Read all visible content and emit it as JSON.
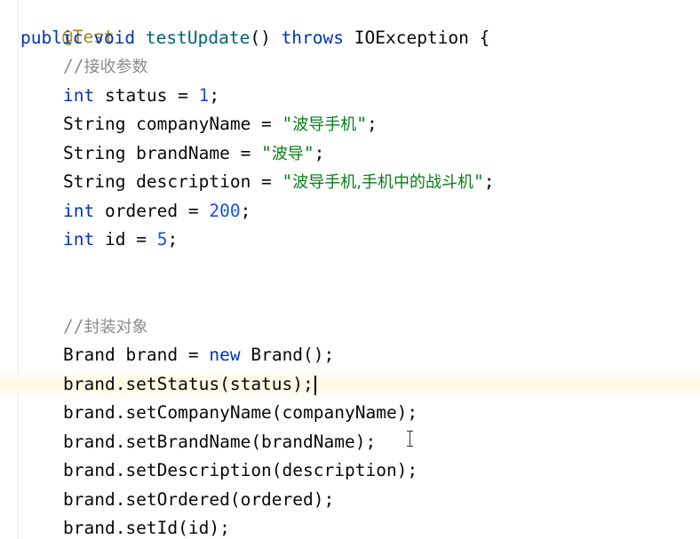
{
  "lines": {
    "l0": {
      "anno": "@Test"
    },
    "l1": {
      "kw1": "public",
      "kw2": "void",
      "name": "testUpdate",
      "rest1": "() ",
      "kw3": "throws",
      "rest2": " IOException {"
    },
    "l2": {
      "prefix": "//",
      "text": "接收参数"
    },
    "l3": {
      "kw": "int",
      "rest": " status = ",
      "num": "1",
      "end": ";"
    },
    "l4": {
      "pre": "String companyName = ",
      "q1": "\"",
      "str": "波导手机",
      "q2": "\"",
      "end": ";"
    },
    "l5": {
      "pre": "String brandName = ",
      "q1": "\"",
      "str": "波导",
      "q2": "\"",
      "end": ";"
    },
    "l6": {
      "pre": "String description = ",
      "q1": "\"",
      "str": "波导手机,手机中的战斗机",
      "q2": "\"",
      "end": ";"
    },
    "l7": {
      "kw": "int",
      "rest": " ordered = ",
      "num": "200",
      "end": ";"
    },
    "l8": {
      "kw": "int",
      "rest": " id = ",
      "num": "5",
      "end": ";"
    },
    "l11": {
      "prefix": "//",
      "text": "封装对象"
    },
    "l12": {
      "pre": "Brand brand = ",
      "kw": "new",
      "post": " Brand();"
    },
    "l13": {
      "text": "brand.setStatus(status);"
    },
    "l14": {
      "text": "brand.setCompanyName(companyName);"
    },
    "l15": {
      "text": "brand.setBrandName(brandName);"
    },
    "l16": {
      "text": "brand.setDescription(description);"
    },
    "l17": {
      "text": "brand.setOrdered(ordered);"
    },
    "l18": {
      "text": "brand.setId(id);"
    }
  },
  "colors": {
    "keyword": "#0033b3",
    "number": "#1750eb",
    "string": "#067d17",
    "annotation": "#9e880d",
    "comment": "#8c8c8c",
    "method": "#00627a"
  }
}
